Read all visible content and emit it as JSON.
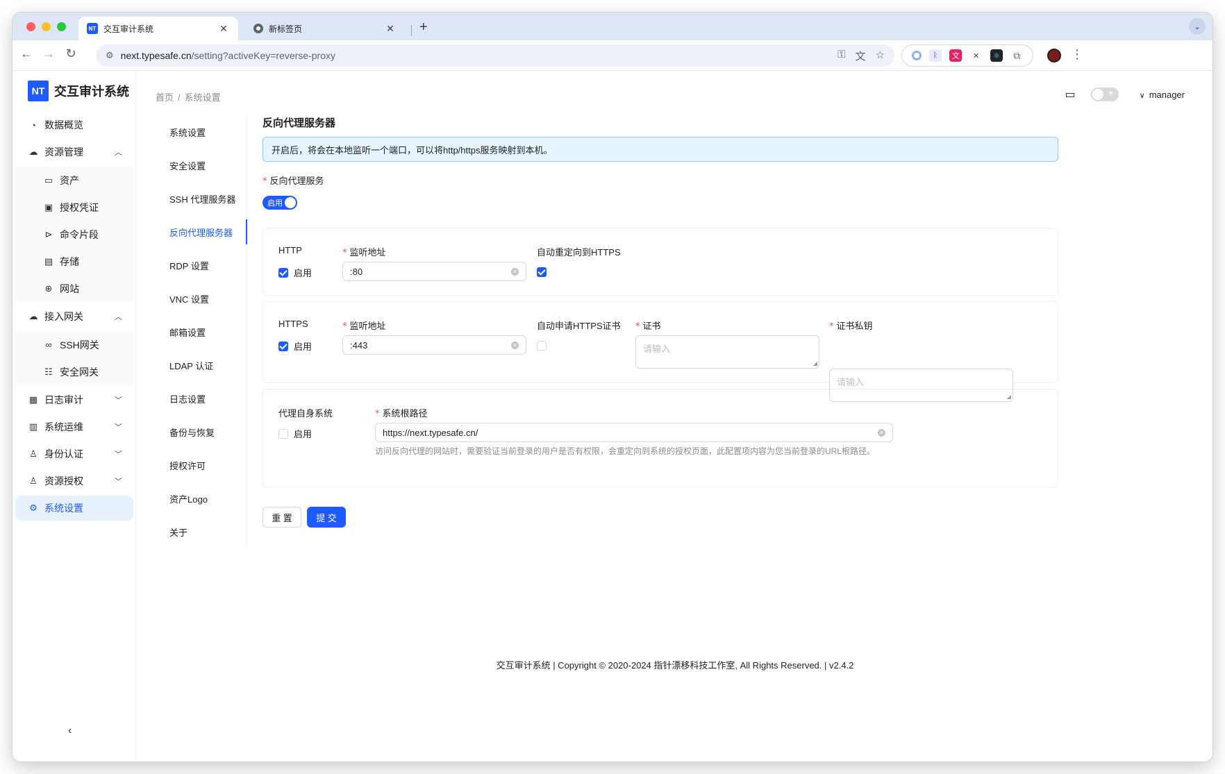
{
  "browser": {
    "tabs": [
      {
        "title": "交互审计系统",
        "favicon": "NT",
        "active": true
      },
      {
        "title": "新标签页",
        "active": false
      }
    ],
    "url_host": "next.typesafe.cn",
    "url_path": "/setting?activeKey=reverse-proxy"
  },
  "app": {
    "logo_text": "NT",
    "name": "交互审计系统"
  },
  "sidebar": {
    "items": [
      {
        "label": "数据概览",
        "icon": "dashboard-icon"
      },
      {
        "label": "资源管理",
        "icon": "cloud-icon",
        "expanded": true
      },
      {
        "label": "资产",
        "icon": "desktop-icon",
        "sub": true
      },
      {
        "label": "授权凭证",
        "icon": "id-card-icon",
        "sub": true
      },
      {
        "label": "命令片段",
        "icon": "terminal-icon",
        "sub": true
      },
      {
        "label": "存储",
        "icon": "storage-icon",
        "sub": true
      },
      {
        "label": "网站",
        "icon": "globe-icon",
        "sub": true
      },
      {
        "label": "接入网关",
        "icon": "gateway-icon",
        "expanded": true
      },
      {
        "label": "SSH网关",
        "icon": "link-icon",
        "sub": true
      },
      {
        "label": "安全网关",
        "icon": "cluster-icon",
        "sub": true
      },
      {
        "label": "日志审计",
        "icon": "audit-icon",
        "expanded": false
      },
      {
        "label": "系统运维",
        "icon": "ops-icon",
        "expanded": false
      },
      {
        "label": "身份认证",
        "icon": "user-icon",
        "expanded": false
      },
      {
        "label": "资源授权",
        "icon": "user-auth-icon",
        "expanded": false
      },
      {
        "label": "系统设置",
        "icon": "gear-icon",
        "active": true
      }
    ]
  },
  "breadcrumb": {
    "home": "首页",
    "current": "系统设置"
  },
  "header": {
    "user": "manager"
  },
  "settings_nav": [
    {
      "label": "系统设置"
    },
    {
      "label": "安全设置"
    },
    {
      "label": "SSH 代理服务器"
    },
    {
      "label": "反向代理服务器",
      "active": true
    },
    {
      "label": "RDP 设置"
    },
    {
      "label": "VNC 设置"
    },
    {
      "label": "邮箱设置"
    },
    {
      "label": "LDAP 认证"
    },
    {
      "label": "日志设置"
    },
    {
      "label": "备份与恢复"
    },
    {
      "label": "授权许可"
    },
    {
      "label": "资产Logo"
    },
    {
      "label": "关于"
    }
  ],
  "content": {
    "title": "反向代理服务器",
    "alert": "开启后，将会在本地监听一个端口，可以将http/https服务映射到本机。",
    "service_label": "反向代理服务",
    "service_switch": "启用",
    "http": {
      "label": "HTTP",
      "enable_label": "启用",
      "enabled": true,
      "listen_label": "监听地址",
      "listen_value": ":80",
      "redirect_label": "自动重定向到HTTPS",
      "redirect_checked": true
    },
    "https": {
      "label": "HTTPS",
      "enable_label": "启用",
      "enabled": true,
      "listen_label": "监听地址",
      "listen_value": ":443",
      "auto_cert_label": "自动申请HTTPS证书",
      "auto_cert_checked": false,
      "cert_label": "证书",
      "cert_placeholder": "请输入",
      "key_label": "证书私钥",
      "key_placeholder": "请输入"
    },
    "self_proxy": {
      "label": "代理自身系统",
      "enable_label": "启用",
      "enabled": false,
      "root_label": "系统根路径",
      "root_value": "https://next.typesafe.cn/",
      "help": "访问反向代理的网站时，需要验证当前登录的用户是否有权限，会重定向到系统的授权页面，此配置项内容为您当前登录的URL根路径。"
    },
    "reset_label": "重 置",
    "submit_label": "提 交"
  },
  "footer": "交互审计系统 | Copyright © 2020-2024 指针漂移科技工作室, All Rights Reserved. | v2.4.2",
  "colors": {
    "primary": "#1e5bff",
    "alert_bg": "#e6f4ff",
    "required": "#ff4d4f"
  }
}
